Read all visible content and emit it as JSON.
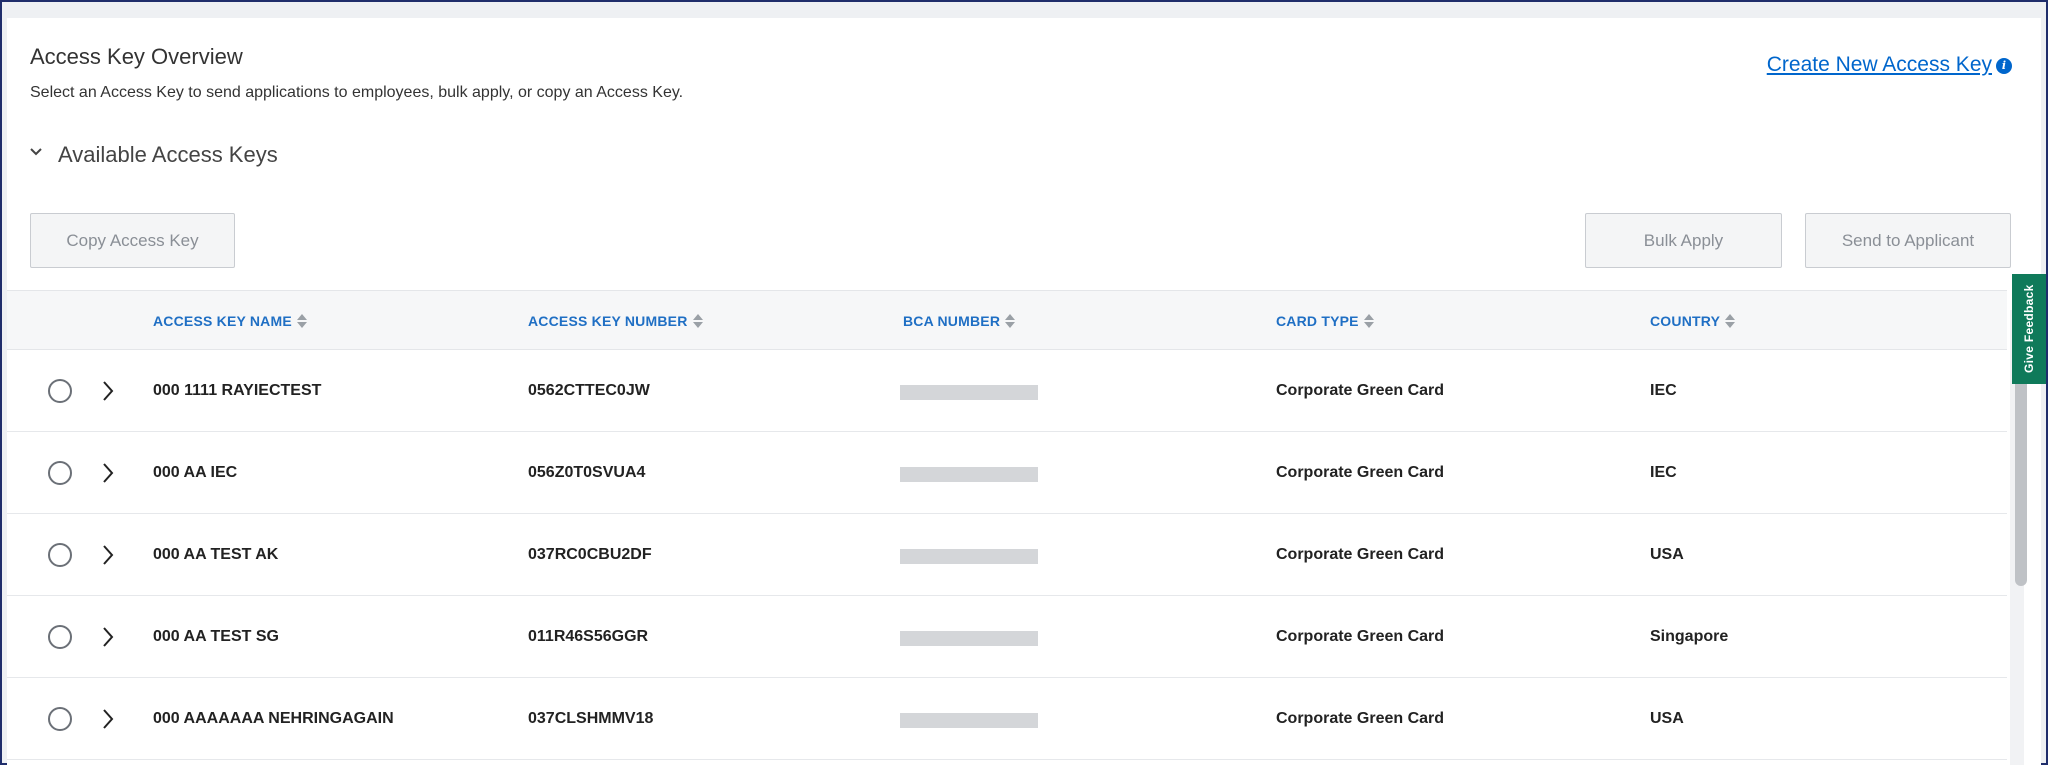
{
  "header": {
    "title": "Access Key Overview",
    "subtitle": "Select an Access Key to send applications to employees, bulk apply, or copy an Access Key.",
    "create_link": "Create New Access Key",
    "info_icon": "info-icon"
  },
  "section": {
    "label": "Available Access Keys",
    "expanded": true
  },
  "actions": {
    "copy_label": "Copy Access Key",
    "bulk_label": "Bulk Apply",
    "send_label": "Send to Applicant"
  },
  "table": {
    "columns": [
      "ACCESS KEY NAME",
      "ACCESS KEY NUMBER",
      "BCA NUMBER",
      "CARD TYPE",
      "COUNTRY"
    ],
    "rows": [
      {
        "name": "000 1111 RAYIECTEST",
        "number": "0562CTTEC0JW",
        "card_type": "Corporate Green Card",
        "country": "IEC"
      },
      {
        "name": "000 AA IEC",
        "number": "056Z0T0SVUA4",
        "card_type": "Corporate Green Card",
        "country": "IEC"
      },
      {
        "name": "000 AA TEST AK",
        "number": "037RC0CBU2DF",
        "card_type": "Corporate Green Card",
        "country": "USA"
      },
      {
        "name": "000 AA TEST SG",
        "number": "011R46S56GGR",
        "card_type": "Corporate Green Card",
        "country": "Singapore"
      },
      {
        "name": "000 AAAAAAA NEHRINGAGAIN",
        "number": "037CLSHMMV18",
        "card_type": "Corporate Green Card",
        "country": "USA"
      }
    ]
  },
  "feedback": {
    "label": "Give Feedback"
  },
  "colors": {
    "link": "#0066cc",
    "header_text": "#1f6fc4",
    "feedback_bg": "#0f7a5a",
    "frame_border": "#1f2d6b"
  }
}
